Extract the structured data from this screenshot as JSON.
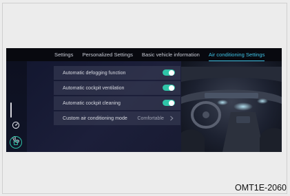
{
  "tabs": [
    {
      "label": "Settings",
      "active": false
    },
    {
      "label": "Personalized Settings",
      "active": false
    },
    {
      "label": "Basic vehicle information",
      "active": false
    },
    {
      "label": "Air conditioning Settings",
      "active": true
    }
  ],
  "settings": [
    {
      "label": "Automatic defogging function",
      "type": "toggle",
      "on": true
    },
    {
      "label": "Automatic cockpit ventilation",
      "type": "toggle",
      "on": true
    },
    {
      "label": "Automatic cockpit cleaning",
      "type": "toggle",
      "on": true
    },
    {
      "label": "Custom air conditioning mode",
      "type": "select",
      "value": "Comfortable"
    }
  ],
  "sidebar": {
    "icons": [
      "speed-limit-icon",
      "phone-icon",
      "home-icon"
    ]
  },
  "footer": {
    "code": "OMT1E-2060"
  },
  "colors": {
    "accent": "#3fc3e6",
    "toggle_on": "#2fc4a8",
    "background": "#0b0d16"
  }
}
